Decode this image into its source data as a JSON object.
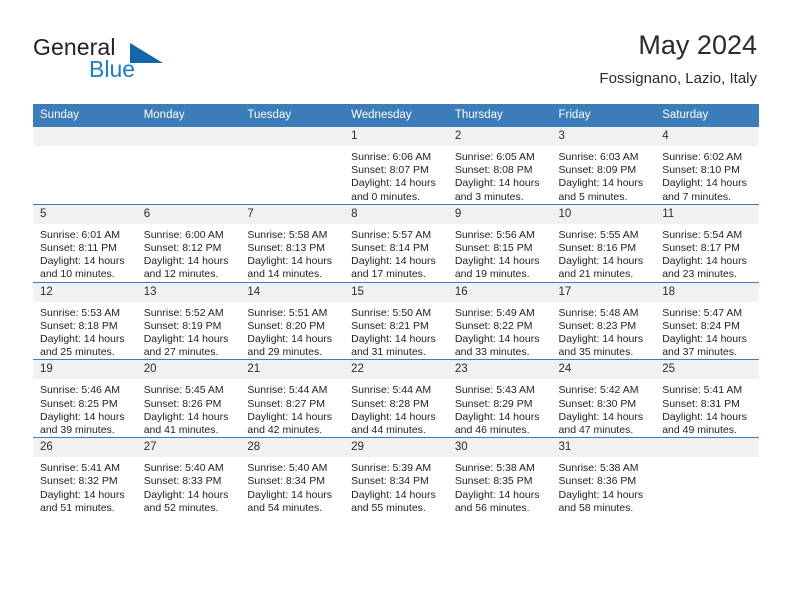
{
  "brand": {
    "name_part1": "General",
    "name_part2": "Blue",
    "logo_icon": "triangle-logo-icon",
    "accent_color": "#1565a8"
  },
  "header": {
    "title": "May 2024",
    "location": "Fossignano, Lazio, Italy"
  },
  "theme": {
    "header_blue": "#3b7cb9",
    "daynum_bg": "#f1f1f1",
    "text": "#1f1f1f"
  },
  "weekdays": [
    "Sunday",
    "Monday",
    "Tuesday",
    "Wednesday",
    "Thursday",
    "Friday",
    "Saturday"
  ],
  "labels": {
    "sunrise": "Sunrise:",
    "sunset": "Sunset:",
    "daylight": "Daylight:"
  },
  "weeks": [
    [
      {
        "day": "",
        "sunrise": "",
        "sunset": "",
        "daylight_line1": "",
        "daylight_line2": ""
      },
      {
        "day": "",
        "sunrise": "",
        "sunset": "",
        "daylight_line1": "",
        "daylight_line2": ""
      },
      {
        "day": "",
        "sunrise": "",
        "sunset": "",
        "daylight_line1": "",
        "daylight_line2": ""
      },
      {
        "day": "1",
        "sunrise": "Sunrise: 6:06 AM",
        "sunset": "Sunset: 8:07 PM",
        "daylight_line1": "Daylight: 14 hours",
        "daylight_line2": "and 0 minutes."
      },
      {
        "day": "2",
        "sunrise": "Sunrise: 6:05 AM",
        "sunset": "Sunset: 8:08 PM",
        "daylight_line1": "Daylight: 14 hours",
        "daylight_line2": "and 3 minutes."
      },
      {
        "day": "3",
        "sunrise": "Sunrise: 6:03 AM",
        "sunset": "Sunset: 8:09 PM",
        "daylight_line1": "Daylight: 14 hours",
        "daylight_line2": "and 5 minutes."
      },
      {
        "day": "4",
        "sunrise": "Sunrise: 6:02 AM",
        "sunset": "Sunset: 8:10 PM",
        "daylight_line1": "Daylight: 14 hours",
        "daylight_line2": "and 7 minutes."
      }
    ],
    [
      {
        "day": "5",
        "sunrise": "Sunrise: 6:01 AM",
        "sunset": "Sunset: 8:11 PM",
        "daylight_line1": "Daylight: 14 hours",
        "daylight_line2": "and 10 minutes."
      },
      {
        "day": "6",
        "sunrise": "Sunrise: 6:00 AM",
        "sunset": "Sunset: 8:12 PM",
        "daylight_line1": "Daylight: 14 hours",
        "daylight_line2": "and 12 minutes."
      },
      {
        "day": "7",
        "sunrise": "Sunrise: 5:58 AM",
        "sunset": "Sunset: 8:13 PM",
        "daylight_line1": "Daylight: 14 hours",
        "daylight_line2": "and 14 minutes."
      },
      {
        "day": "8",
        "sunrise": "Sunrise: 5:57 AM",
        "sunset": "Sunset: 8:14 PM",
        "daylight_line1": "Daylight: 14 hours",
        "daylight_line2": "and 17 minutes."
      },
      {
        "day": "9",
        "sunrise": "Sunrise: 5:56 AM",
        "sunset": "Sunset: 8:15 PM",
        "daylight_line1": "Daylight: 14 hours",
        "daylight_line2": "and 19 minutes."
      },
      {
        "day": "10",
        "sunrise": "Sunrise: 5:55 AM",
        "sunset": "Sunset: 8:16 PM",
        "daylight_line1": "Daylight: 14 hours",
        "daylight_line2": "and 21 minutes."
      },
      {
        "day": "11",
        "sunrise": "Sunrise: 5:54 AM",
        "sunset": "Sunset: 8:17 PM",
        "daylight_line1": "Daylight: 14 hours",
        "daylight_line2": "and 23 minutes."
      }
    ],
    [
      {
        "day": "12",
        "sunrise": "Sunrise: 5:53 AM",
        "sunset": "Sunset: 8:18 PM",
        "daylight_line1": "Daylight: 14 hours",
        "daylight_line2": "and 25 minutes."
      },
      {
        "day": "13",
        "sunrise": "Sunrise: 5:52 AM",
        "sunset": "Sunset: 8:19 PM",
        "daylight_line1": "Daylight: 14 hours",
        "daylight_line2": "and 27 minutes."
      },
      {
        "day": "14",
        "sunrise": "Sunrise: 5:51 AM",
        "sunset": "Sunset: 8:20 PM",
        "daylight_line1": "Daylight: 14 hours",
        "daylight_line2": "and 29 minutes."
      },
      {
        "day": "15",
        "sunrise": "Sunrise: 5:50 AM",
        "sunset": "Sunset: 8:21 PM",
        "daylight_line1": "Daylight: 14 hours",
        "daylight_line2": "and 31 minutes."
      },
      {
        "day": "16",
        "sunrise": "Sunrise: 5:49 AM",
        "sunset": "Sunset: 8:22 PM",
        "daylight_line1": "Daylight: 14 hours",
        "daylight_line2": "and 33 minutes."
      },
      {
        "day": "17",
        "sunrise": "Sunrise: 5:48 AM",
        "sunset": "Sunset: 8:23 PM",
        "daylight_line1": "Daylight: 14 hours",
        "daylight_line2": "and 35 minutes."
      },
      {
        "day": "18",
        "sunrise": "Sunrise: 5:47 AM",
        "sunset": "Sunset: 8:24 PM",
        "daylight_line1": "Daylight: 14 hours",
        "daylight_line2": "and 37 minutes."
      }
    ],
    [
      {
        "day": "19",
        "sunrise": "Sunrise: 5:46 AM",
        "sunset": "Sunset: 8:25 PM",
        "daylight_line1": "Daylight: 14 hours",
        "daylight_line2": "and 39 minutes."
      },
      {
        "day": "20",
        "sunrise": "Sunrise: 5:45 AM",
        "sunset": "Sunset: 8:26 PM",
        "daylight_line1": "Daylight: 14 hours",
        "daylight_line2": "and 41 minutes."
      },
      {
        "day": "21",
        "sunrise": "Sunrise: 5:44 AM",
        "sunset": "Sunset: 8:27 PM",
        "daylight_line1": "Daylight: 14 hours",
        "daylight_line2": "and 42 minutes."
      },
      {
        "day": "22",
        "sunrise": "Sunrise: 5:44 AM",
        "sunset": "Sunset: 8:28 PM",
        "daylight_line1": "Daylight: 14 hours",
        "daylight_line2": "and 44 minutes."
      },
      {
        "day": "23",
        "sunrise": "Sunrise: 5:43 AM",
        "sunset": "Sunset: 8:29 PM",
        "daylight_line1": "Daylight: 14 hours",
        "daylight_line2": "and 46 minutes."
      },
      {
        "day": "24",
        "sunrise": "Sunrise: 5:42 AM",
        "sunset": "Sunset: 8:30 PM",
        "daylight_line1": "Daylight: 14 hours",
        "daylight_line2": "and 47 minutes."
      },
      {
        "day": "25",
        "sunrise": "Sunrise: 5:41 AM",
        "sunset": "Sunset: 8:31 PM",
        "daylight_line1": "Daylight: 14 hours",
        "daylight_line2": "and 49 minutes."
      }
    ],
    [
      {
        "day": "26",
        "sunrise": "Sunrise: 5:41 AM",
        "sunset": "Sunset: 8:32 PM",
        "daylight_line1": "Daylight: 14 hours",
        "daylight_line2": "and 51 minutes."
      },
      {
        "day": "27",
        "sunrise": "Sunrise: 5:40 AM",
        "sunset": "Sunset: 8:33 PM",
        "daylight_line1": "Daylight: 14 hours",
        "daylight_line2": "and 52 minutes."
      },
      {
        "day": "28",
        "sunrise": "Sunrise: 5:40 AM",
        "sunset": "Sunset: 8:34 PM",
        "daylight_line1": "Daylight: 14 hours",
        "daylight_line2": "and 54 minutes."
      },
      {
        "day": "29",
        "sunrise": "Sunrise: 5:39 AM",
        "sunset": "Sunset: 8:34 PM",
        "daylight_line1": "Daylight: 14 hours",
        "daylight_line2": "and 55 minutes."
      },
      {
        "day": "30",
        "sunrise": "Sunrise: 5:38 AM",
        "sunset": "Sunset: 8:35 PM",
        "daylight_line1": "Daylight: 14 hours",
        "daylight_line2": "and 56 minutes."
      },
      {
        "day": "31",
        "sunrise": "Sunrise: 5:38 AM",
        "sunset": "Sunset: 8:36 PM",
        "daylight_line1": "Daylight: 14 hours",
        "daylight_line2": "and 58 minutes."
      },
      {
        "day": "",
        "sunrise": "",
        "sunset": "",
        "daylight_line1": "",
        "daylight_line2": ""
      }
    ]
  ]
}
